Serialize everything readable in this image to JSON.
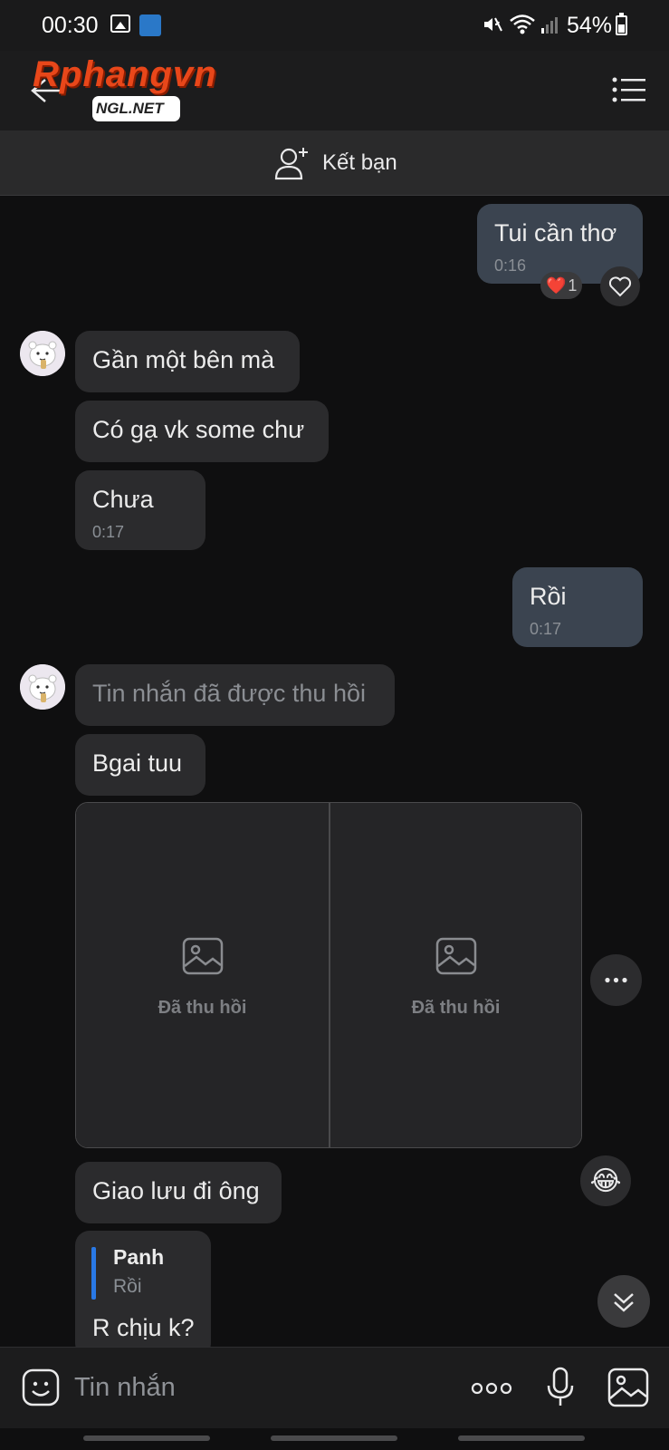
{
  "status_bar": {
    "time": "00:30",
    "battery": "54%"
  },
  "header": {
    "watermark_logo": "Rphangvn",
    "watermark_sub": "NGL.NET"
  },
  "add_friend": {
    "label": "Kết bạn"
  },
  "messages": [
    {
      "side": "out",
      "text": "Tui cần thơ",
      "time": "0:16",
      "reaction": {
        "emoji": "❤️",
        "count": "1"
      }
    },
    {
      "side": "in",
      "text": "Gần một bên mà"
    },
    {
      "side": "in",
      "text": "Có gạ vk some chư"
    },
    {
      "side": "in",
      "text": "Chưa",
      "time": "0:17"
    },
    {
      "side": "out",
      "text": "Rồi",
      "time": "0:17"
    },
    {
      "side": "in",
      "text": "Tin nhắn đã được thu hồi",
      "recalled": true
    },
    {
      "side": "in",
      "text": "Bgai tuu"
    },
    {
      "side": "in",
      "type": "images",
      "images": [
        {
          "label": "Đã thu hồi"
        },
        {
          "label": "Đã thu hồi"
        }
      ]
    },
    {
      "side": "in",
      "text": "Giao lưu đi ông",
      "quick_reaction": "😂"
    },
    {
      "side": "in",
      "reply_to": {
        "name": "Panh",
        "text": "Rồi"
      },
      "text": "R chịu k?"
    }
  ],
  "composer": {
    "placeholder": "Tin nhắn"
  },
  "colors": {
    "background": "#0f0f10",
    "bubble_in": "#2b2b2d",
    "bubble_out": "#3b4450",
    "accent_blue": "#2979e6",
    "logo_orange": "#e8471a"
  }
}
